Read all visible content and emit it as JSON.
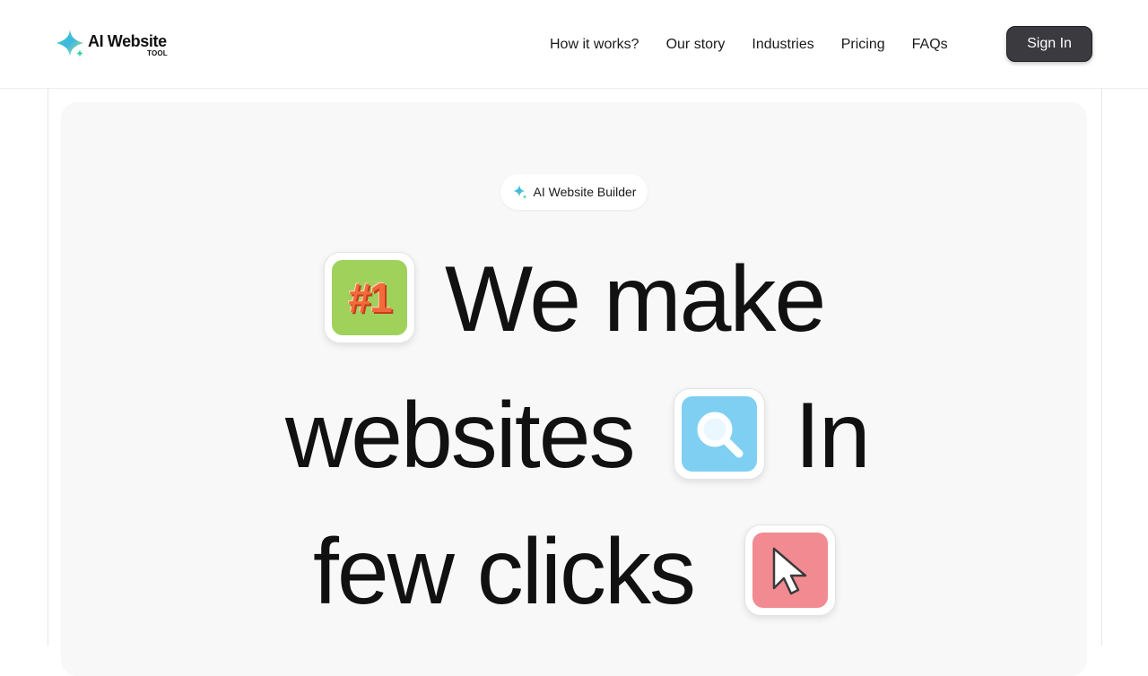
{
  "brand": {
    "name": "AI Website",
    "sub": "TOOL",
    "accent_colors": [
      "#2fd4a3",
      "#3fb7e8",
      "#b8f05a"
    ]
  },
  "nav": {
    "items": [
      {
        "label": "How it works?"
      },
      {
        "label": "Our story"
      },
      {
        "label": "Industries"
      },
      {
        "label": "Pricing"
      },
      {
        "label": "FAQs"
      }
    ],
    "signin_label": "Sign In"
  },
  "hero": {
    "badge_label": "AI Website Builder",
    "line1": "We make",
    "line2a": "websites",
    "line2b": "In",
    "line3": "few clicks",
    "tiles": [
      {
        "icon": "number-one-icon",
        "text": "#1",
        "bg": "#9fd15b"
      },
      {
        "icon": "search-icon",
        "bg": "#7fcff2"
      },
      {
        "icon": "cursor-arrow-icon",
        "bg": "#f28a91"
      }
    ]
  }
}
